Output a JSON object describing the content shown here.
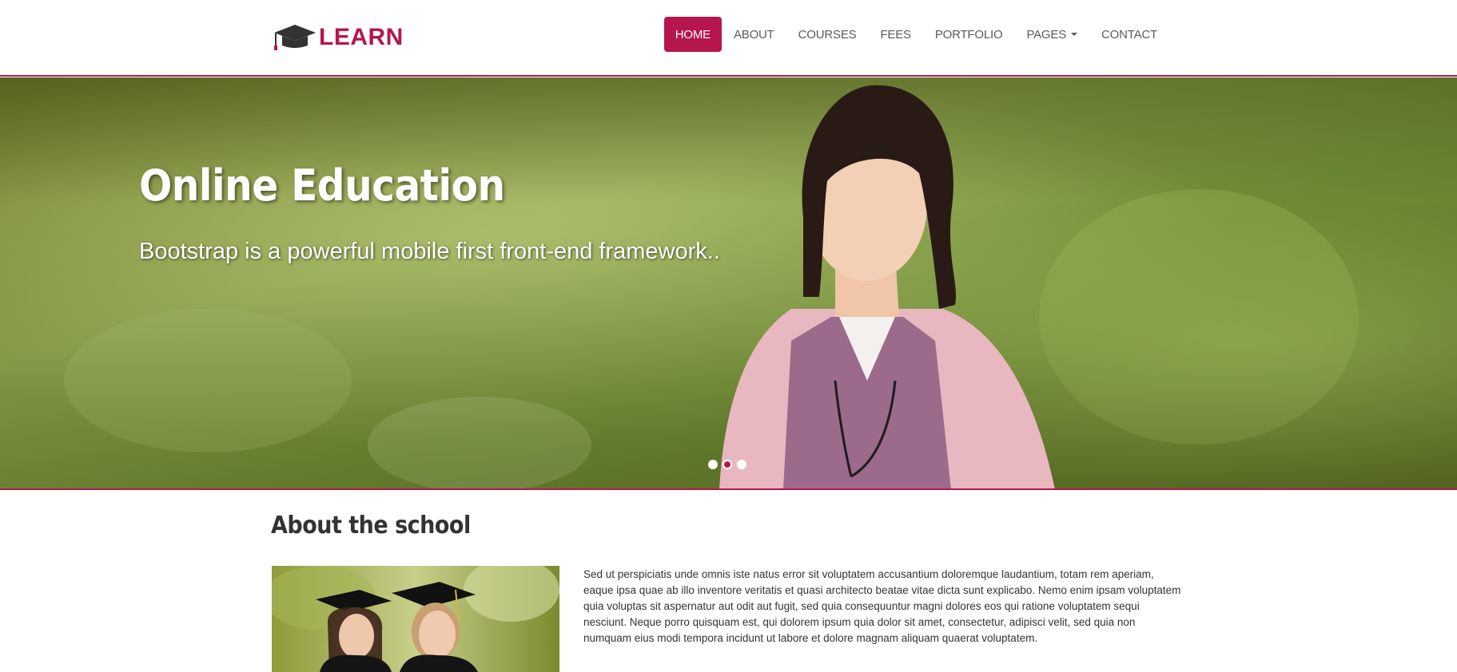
{
  "header": {
    "logo_text": "LEARN",
    "brand_color": "#b5164d",
    "nav": [
      {
        "label": "HOME",
        "active": true
      },
      {
        "label": "ABOUT"
      },
      {
        "label": "COURSES"
      },
      {
        "label": "FEES"
      },
      {
        "label": "PORTFOLIO"
      },
      {
        "label": "PAGES",
        "dropdown": true
      },
      {
        "label": "CONTACT"
      }
    ]
  },
  "hero": {
    "title": "Online Education",
    "subtitle": "Bootstrap is a powerful mobile first front-end framework..",
    "slides": 3,
    "active_slide": 2
  },
  "about": {
    "title": "About the school",
    "paragraph": "Sed ut perspiciatis unde omnis iste natus error sit voluptatem accusantium doloremque laudantium, totam rem aperiam, eaque ipsa quae ab illo inventore veritatis et quasi architecto beatae vitae dicta sunt explicabo. Nemo enim ipsam voluptatem quia voluptas sit aspernatur aut odit aut fugit, sed quia consequuntur magni dolores eos qui ratione voluptatem sequi nesciunt. Neque porro quisquam est, qui dolorem ipsum quia dolor sit amet, consectetur, adipisci velit, sed quia non numquam eius modi tempora incidunt ut labore et dolore magnam aliquam quaerat voluptatem."
  }
}
